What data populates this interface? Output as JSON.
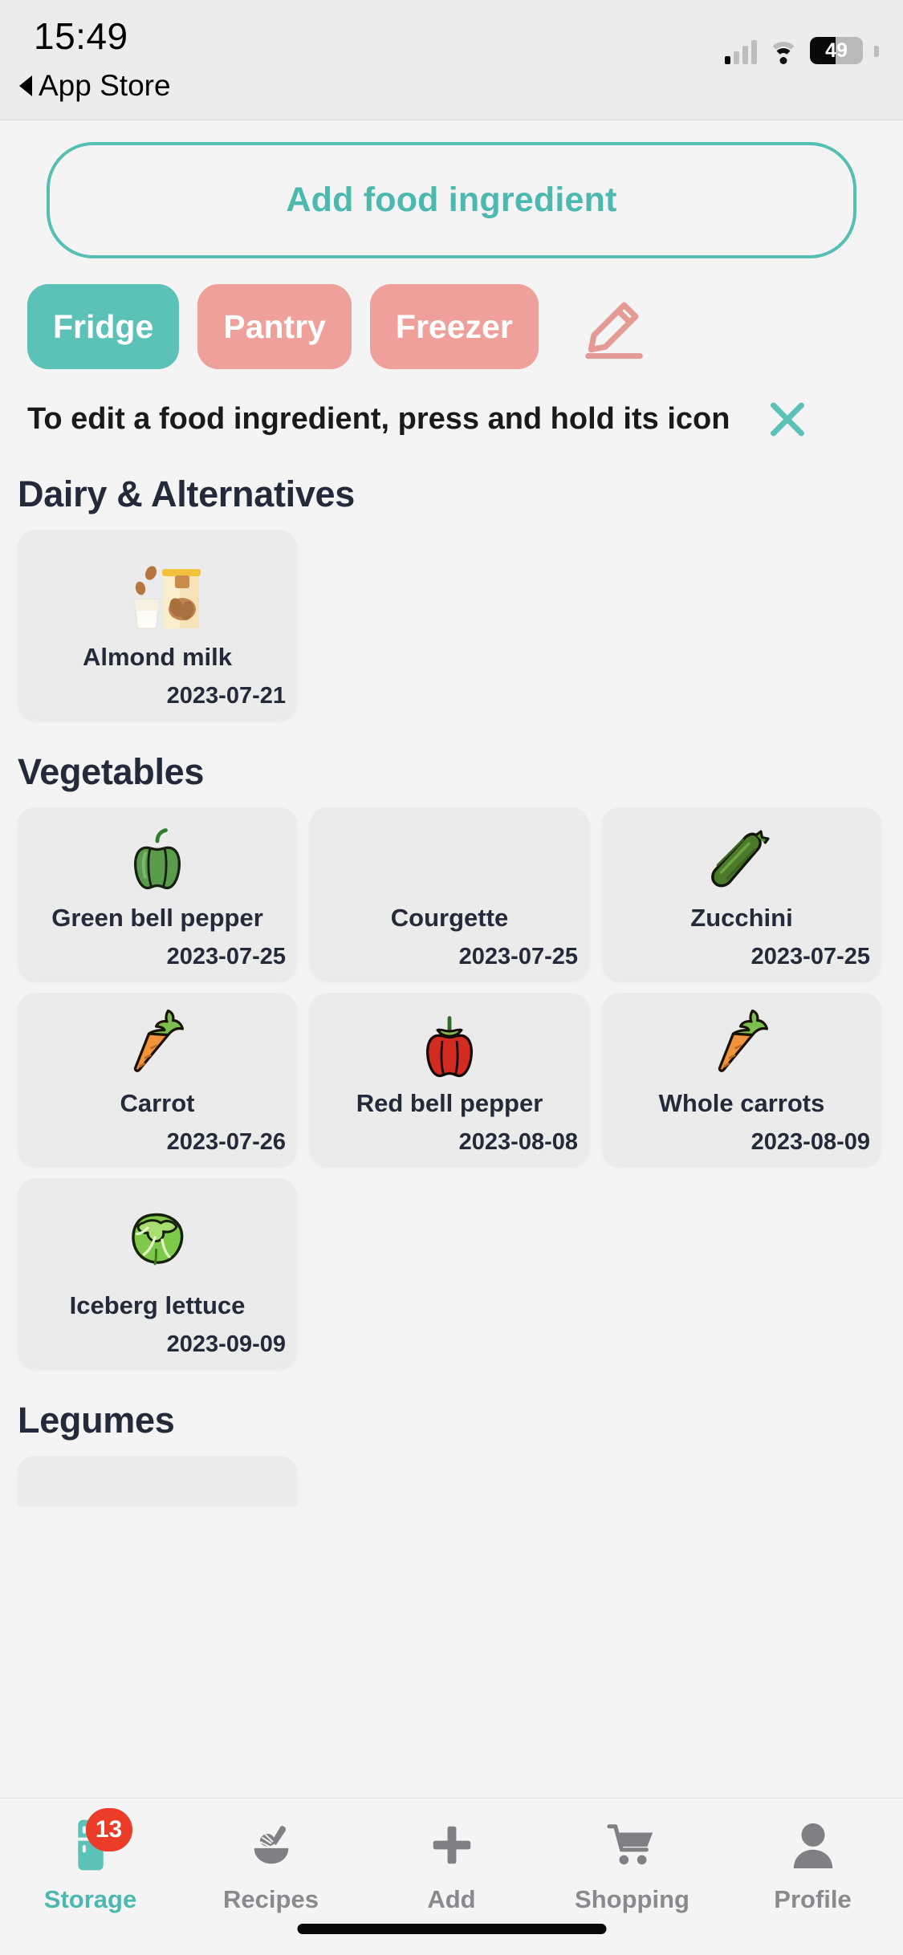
{
  "status_bar": {
    "time": "15:49",
    "back_label": "App Store",
    "back_icon": "triangle-left-icon",
    "signal_icon": "cellular-signal-icon",
    "wifi_icon": "wifi-icon",
    "battery_icon": "battery-icon",
    "battery_level": "49",
    "battery_percent": 49
  },
  "header": {
    "add_button_label": "Add food ingredient"
  },
  "storage_tabs": [
    {
      "label": "Fridge",
      "active": true
    },
    {
      "label": "Pantry",
      "active": false
    },
    {
      "label": "Freezer",
      "active": false
    }
  ],
  "edit_button": {
    "icon": "pencil-edit-icon"
  },
  "hint": {
    "text": "To edit a food ingredient, press and hold its icon",
    "close_icon": "close-x-icon"
  },
  "sections": [
    {
      "title": "Dairy & Alternatives",
      "items": [
        {
          "name": "Almond milk",
          "date": "2023-07-21",
          "icon": "almond-milk-icon"
        }
      ]
    },
    {
      "title": "Vegetables",
      "items": [
        {
          "name": "Green bell pepper",
          "date": "2023-07-25",
          "icon": "green-bell-pepper-icon"
        },
        {
          "name": "Courgette",
          "date": "2023-07-25",
          "icon": "none"
        },
        {
          "name": "Zucchini",
          "date": "2023-07-25",
          "icon": "zucchini-icon"
        },
        {
          "name": "Carrot",
          "date": "2023-07-26",
          "icon": "carrot-icon"
        },
        {
          "name": "Red bell pepper",
          "date": "2023-08-08",
          "icon": "red-bell-pepper-icon"
        },
        {
          "name": "Whole carrots",
          "date": "2023-08-09",
          "icon": "carrot-icon"
        },
        {
          "name": "Iceberg lettuce",
          "date": "2023-09-09",
          "icon": "lettuce-icon"
        }
      ]
    },
    {
      "title": "Legumes",
      "items": []
    }
  ],
  "tab_bar": [
    {
      "label": "Storage",
      "icon": "fridge-icon",
      "badge": "13",
      "active": true
    },
    {
      "label": "Recipes",
      "icon": "bowl-whisk-icon",
      "badge": "",
      "active": false
    },
    {
      "label": "Add",
      "icon": "plus-icon",
      "badge": "",
      "active": false
    },
    {
      "label": "Shopping",
      "icon": "shopping-cart-icon",
      "badge": "",
      "active": false
    },
    {
      "label": "Profile",
      "icon": "person-icon",
      "badge": "",
      "active": false
    }
  ],
  "colors": {
    "accent_teal": "#4cb9ae",
    "tab_active": "#5cc2b7",
    "tab_inactive": "#efa09a",
    "badge_red": "#ea3c28",
    "card_bg": "#ebebec",
    "page_bg": "#f4f4f5",
    "text_dark": "#242a3a"
  }
}
